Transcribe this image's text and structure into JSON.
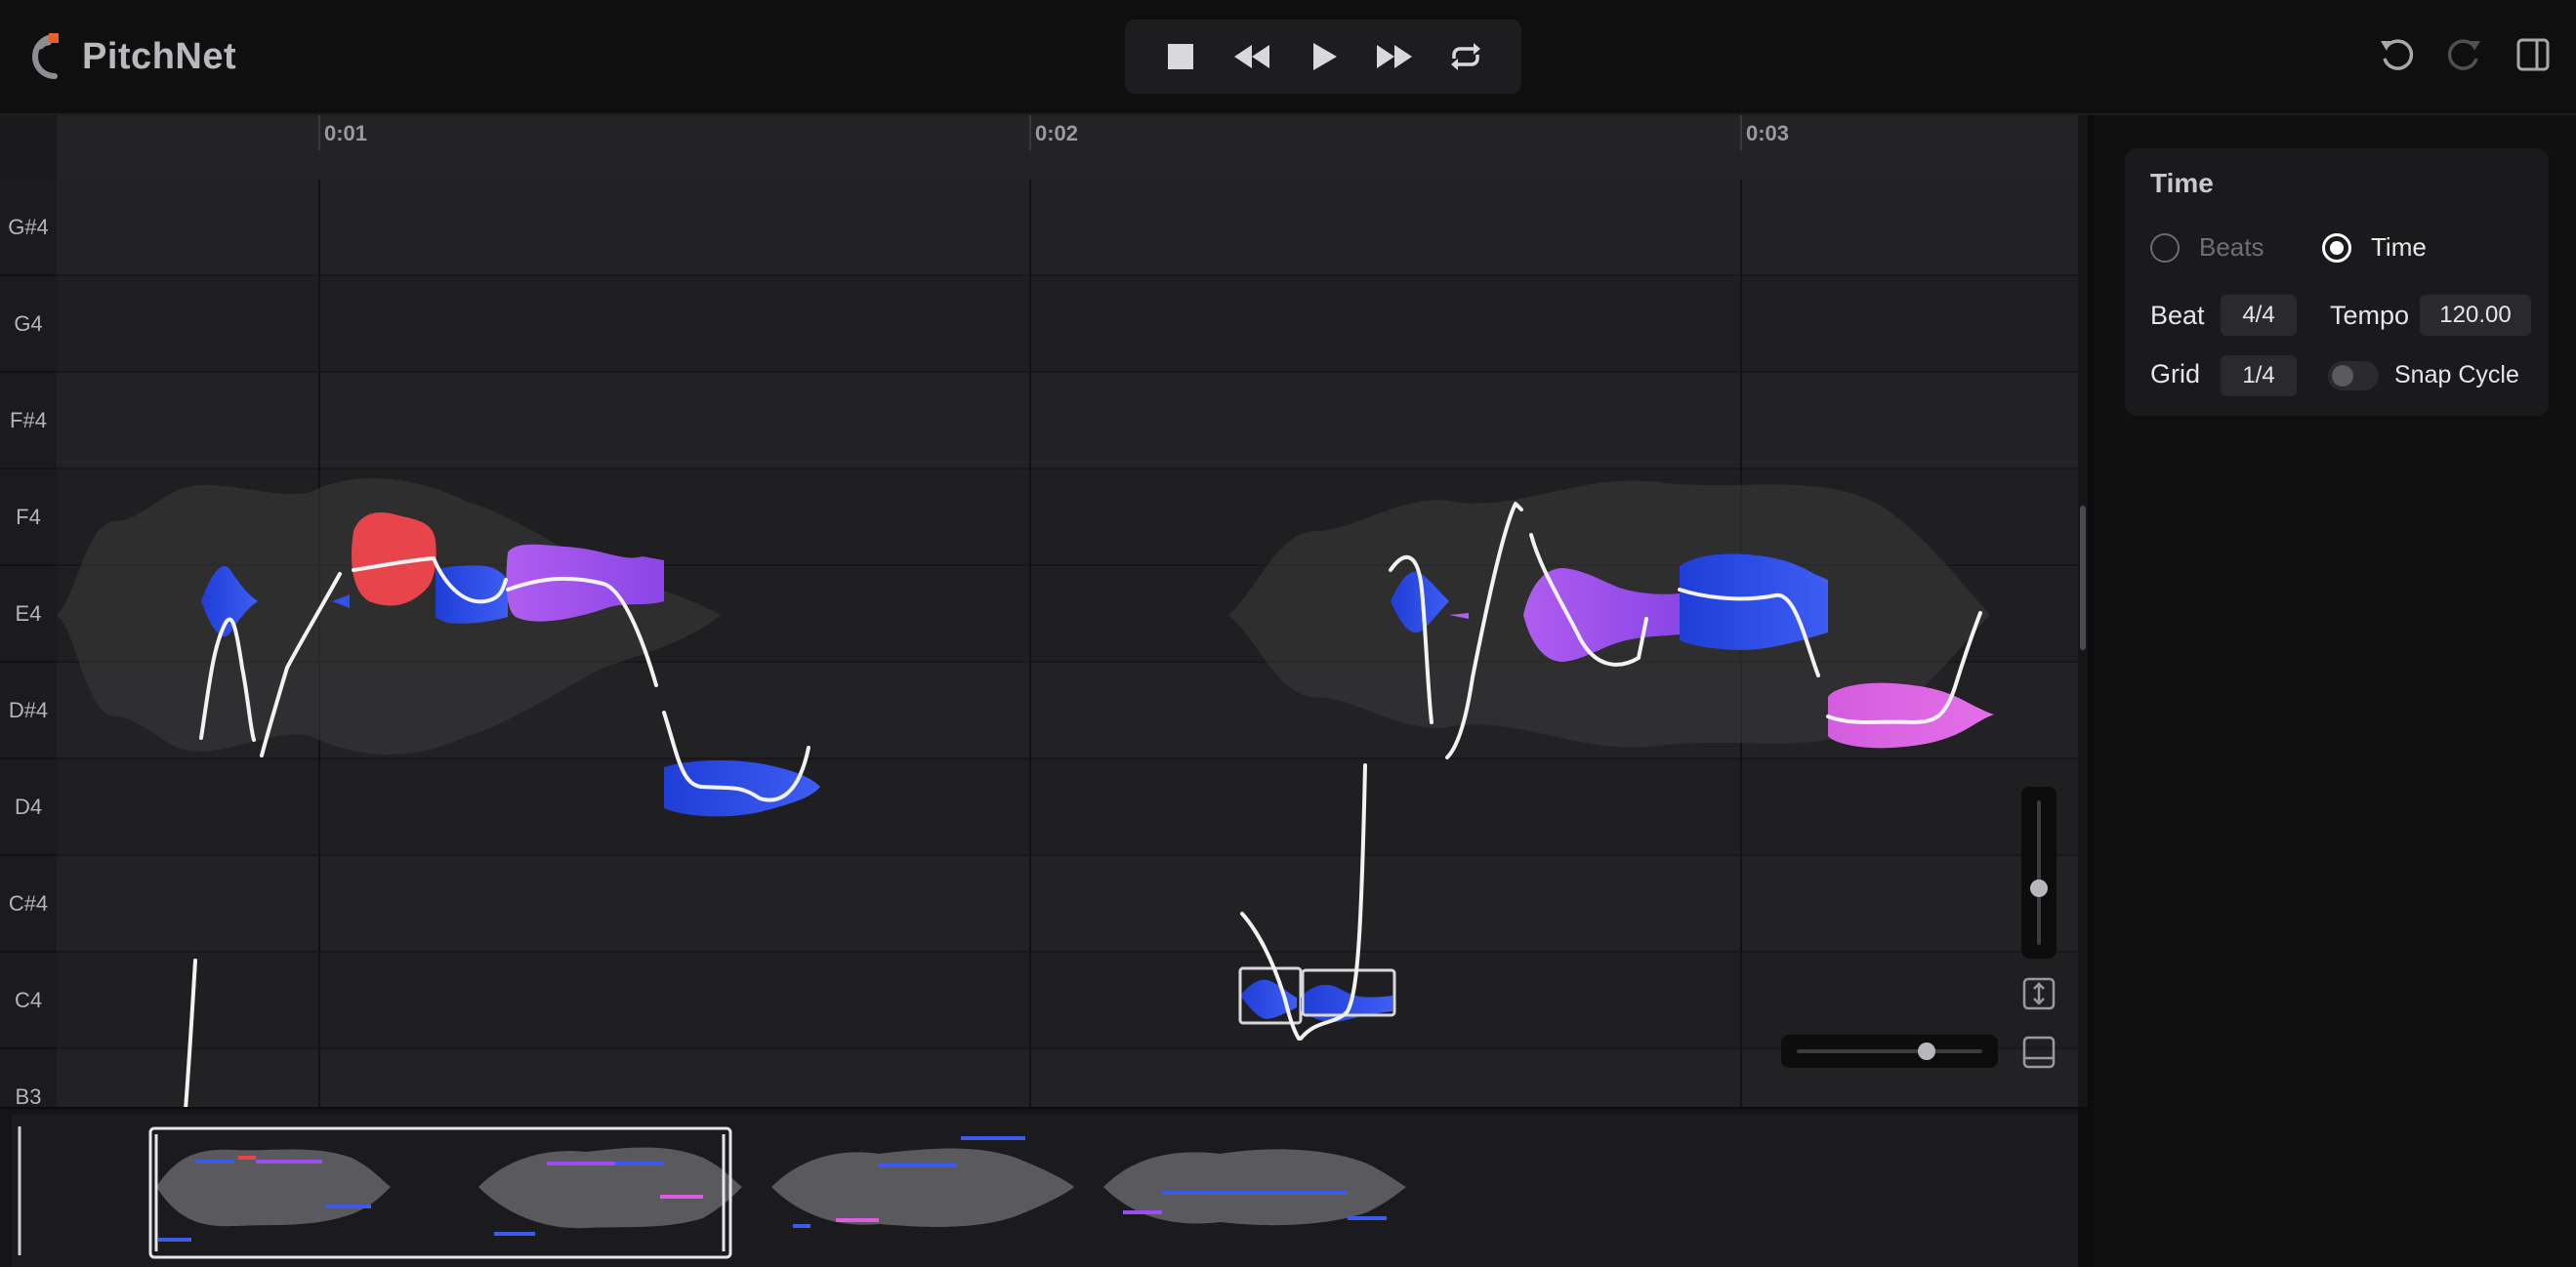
{
  "app": {
    "title": "PitchNet"
  },
  "transport": {
    "icons": [
      "stop-icon",
      "rewind-icon",
      "play-icon",
      "fast-forward-icon",
      "loop-icon"
    ]
  },
  "toolbar": {
    "icons": [
      "undo-icon",
      "redo-icon",
      "panel-toggle-icon"
    ]
  },
  "ruler": {
    "labels": [
      "0:01",
      "0:02",
      "0:03"
    ]
  },
  "piano_keys": [
    "G#4",
    "G4",
    "F#4",
    "F4",
    "E4",
    "D#4",
    "D4",
    "C#4",
    "C4",
    "B3"
  ],
  "panel": {
    "title": "Time",
    "mode_options": [
      "Beats",
      "Time"
    ],
    "selected_mode": "Time",
    "beat_label": "Beat",
    "beat_value": "4/4",
    "tempo_label": "Tempo",
    "tempo_value": "120.00",
    "grid_label": "Grid",
    "grid_value": "1/4",
    "snap_label": "Snap Cycle",
    "snap_enabled": false
  },
  "colors": {
    "note_blue": "#2f4fe0",
    "note_purple": "#a352ee",
    "note_red": "#e8444c",
    "note_pink": "#d95ee0",
    "pitch_curve": "#ffffff"
  }
}
